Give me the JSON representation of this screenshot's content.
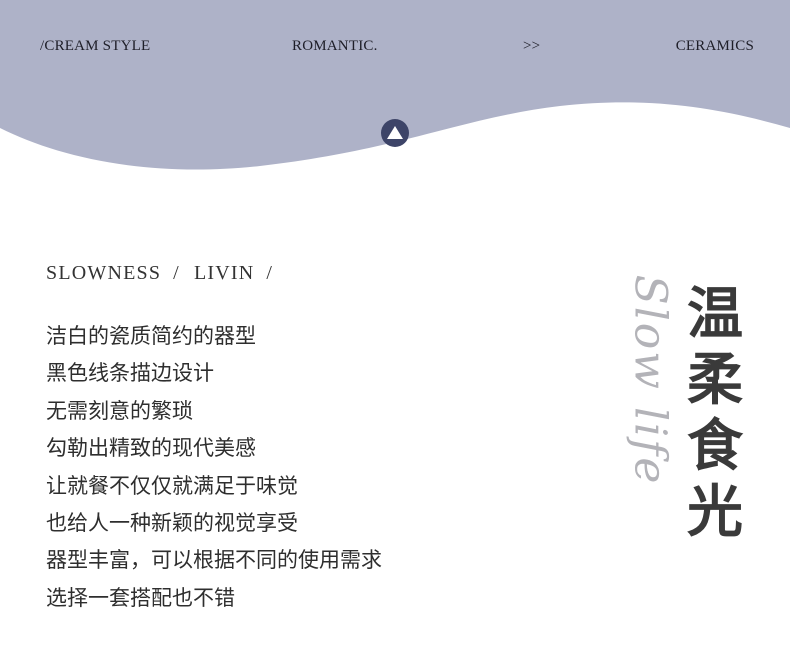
{
  "header": {
    "nav_items": [
      "/CREAM STYLE",
      "ROMANTIC.",
      ">>",
      "CERAMICS"
    ],
    "background_color": "#aeb2c8",
    "badge_color": "#3d4468",
    "badge_icon": "triangle-up-icon"
  },
  "subtitle": {
    "left": "SLOWNESS",
    "right": "LIVIN",
    "separator": "/"
  },
  "body_lines": [
    "洁白的瓷质简约的器型",
    "黑色线条描边设计",
    "无需刻意的繁琐",
    "勾勒出精致的现代美感",
    "让就餐不仅仅就满足于味觉",
    "也给人一种新颖的视觉享受",
    "器型丰富，可以根据不同的使用需求",
    "选择一套搭配也不错"
  ],
  "vertical_title": [
    "温",
    "柔",
    "食",
    "光"
  ],
  "script_text": "Slow life"
}
